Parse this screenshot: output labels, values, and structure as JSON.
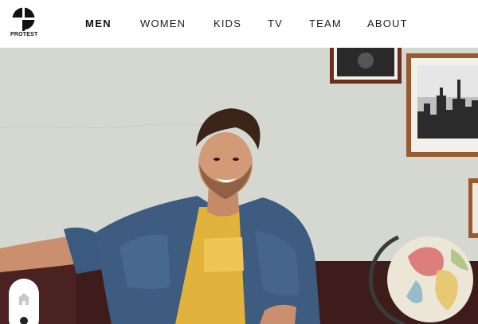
{
  "brand": {
    "name": "PROTEST",
    "logo_icon": "protest-cross-logo"
  },
  "nav": {
    "items": [
      {
        "label": "MEN",
        "active": true
      },
      {
        "label": "WOMEN",
        "active": false
      },
      {
        "label": "KIDS",
        "active": false
      },
      {
        "label": "TV",
        "active": false
      },
      {
        "label": "TEAM",
        "active": false
      },
      {
        "label": "ABOUT",
        "active": false
      }
    ]
  },
  "side_widget": {
    "icons": [
      "home-icon",
      "dot-indicator-icon"
    ]
  },
  "colors": {
    "wall": "#d9dcd6",
    "shirt_yellow": "#e3b43a",
    "denim": "#3e5b80",
    "sofa": "#4a2121",
    "frame_wood": "#8a4a2a"
  }
}
